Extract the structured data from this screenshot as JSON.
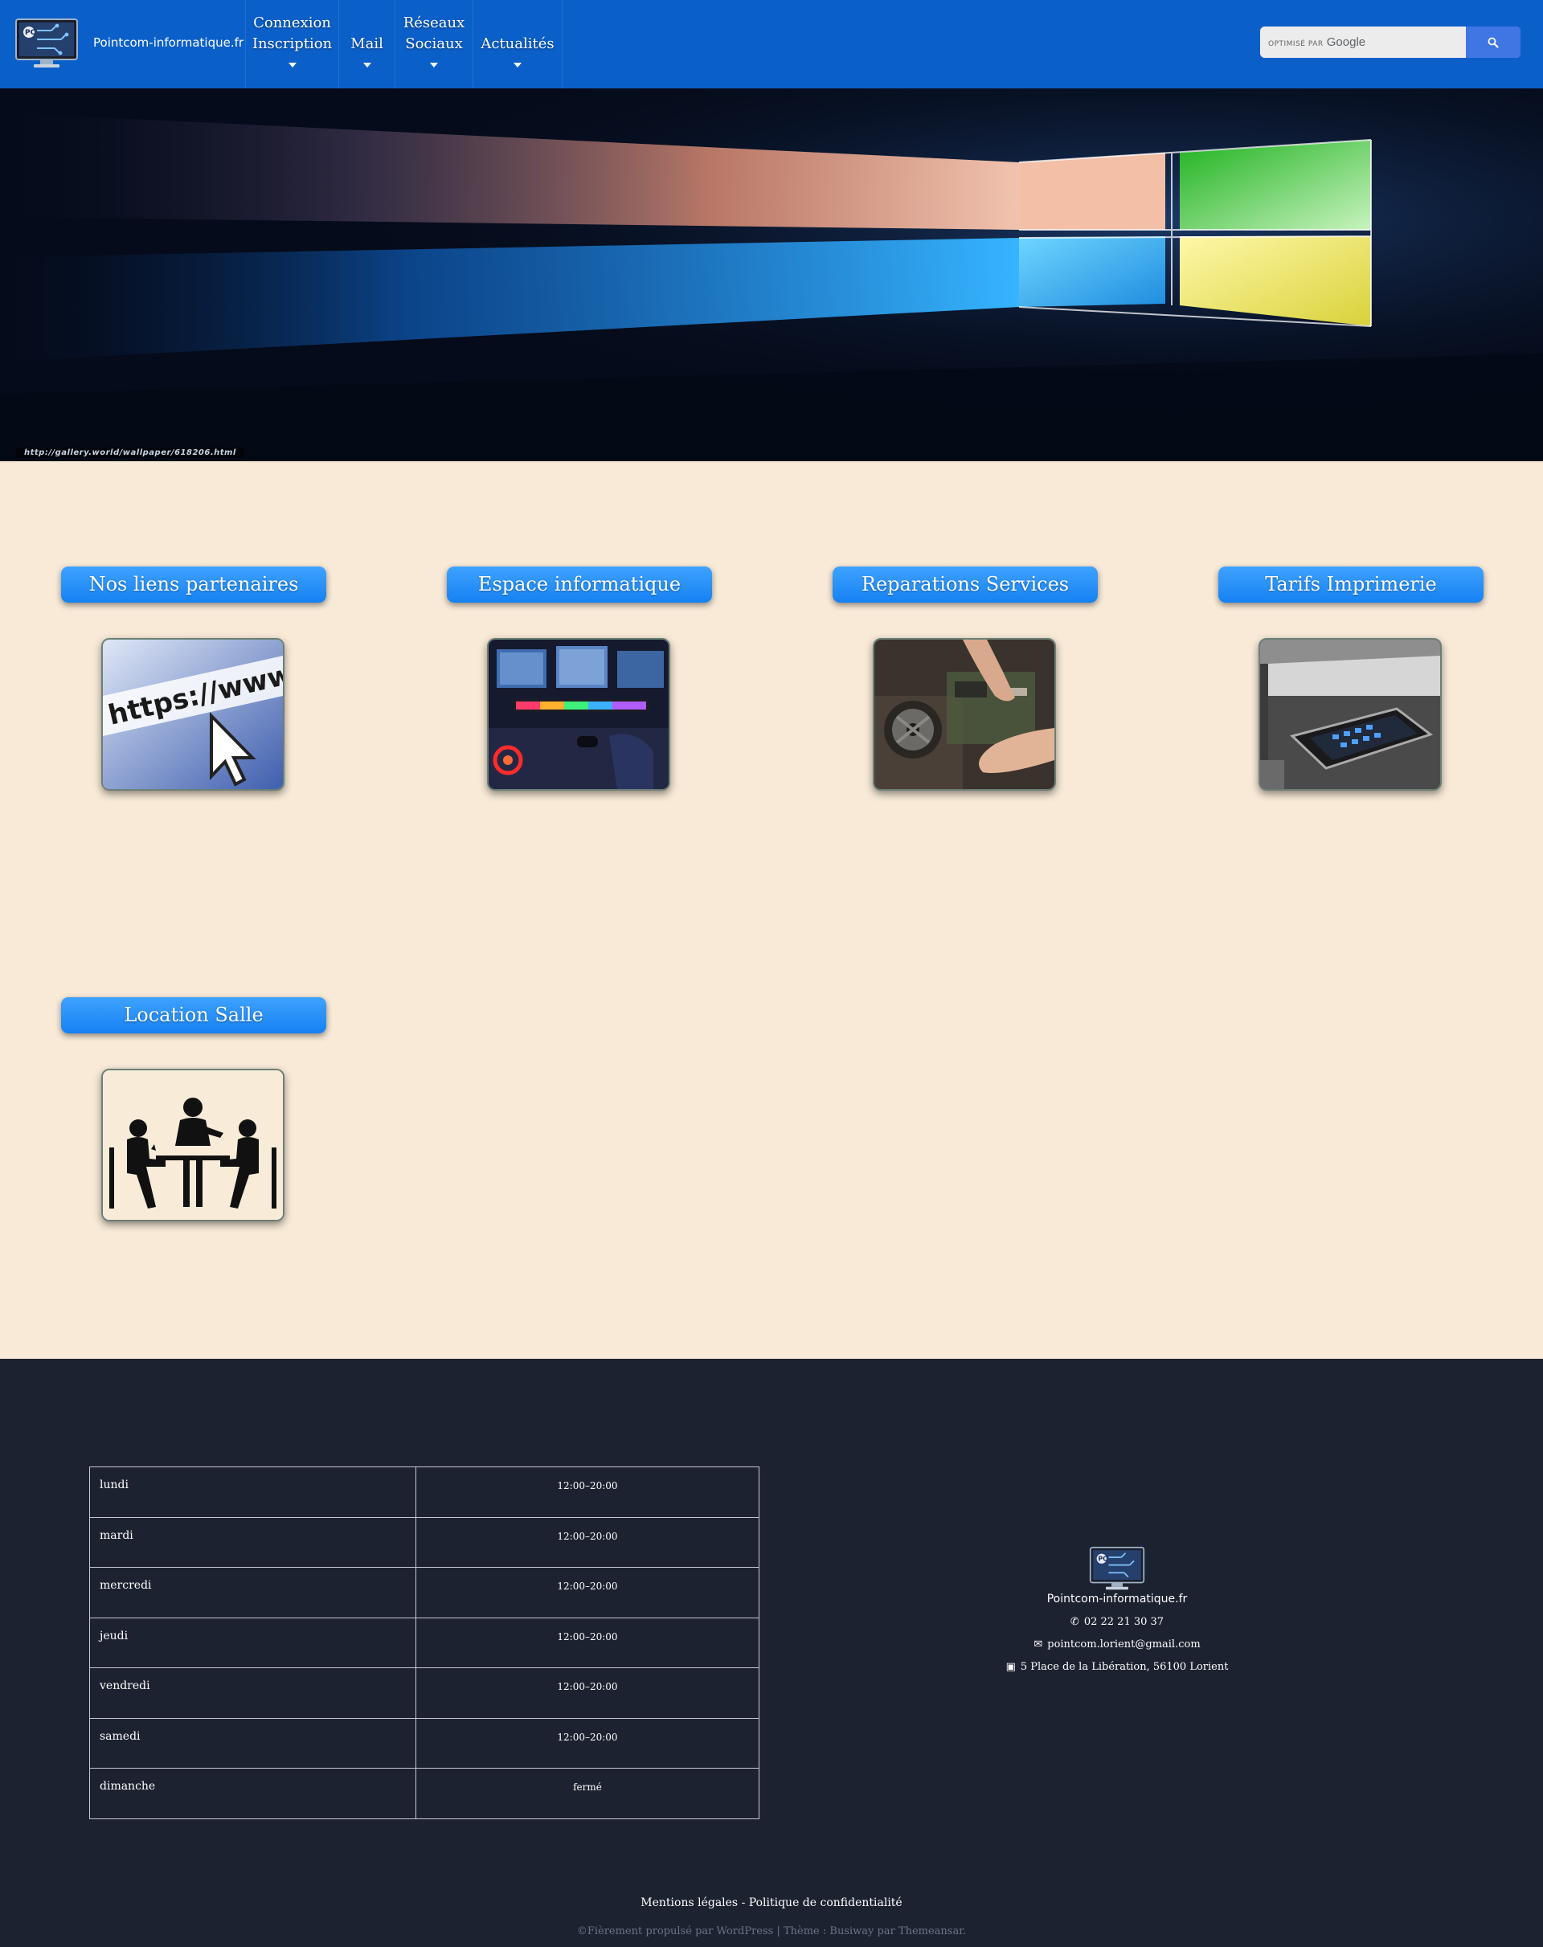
{
  "header": {
    "site_name": "Pointcom-informatique.fr",
    "nav": [
      {
        "line1": "Connexion",
        "line2": "Inscription"
      },
      {
        "line1": "Mail",
        "line2": ""
      },
      {
        "line1": "Réseaux",
        "line2": "Sociaux"
      },
      {
        "line1": "Actualités",
        "line2": ""
      }
    ],
    "search": {
      "optimise_label": "OPTIMISÉ PAR",
      "google_label": "Google"
    }
  },
  "hero": {
    "credit": "http://gallery.world/wallpaper/618206.html"
  },
  "services": [
    {
      "title": "Nos liens partenaires",
      "image": "https-url-cursor"
    },
    {
      "title": "Espace informatique",
      "image": "gaming-pc-room"
    },
    {
      "title": "Reparations Services",
      "image": "computer-repair-hands"
    },
    {
      "title": "Tarifs Imprimerie",
      "image": "office-printer"
    },
    {
      "title": "Location Salle",
      "image": "meeting-table-pictogram"
    }
  ],
  "hours": [
    {
      "day": "lundi",
      "time": "12:00–20:00"
    },
    {
      "day": "mardi",
      "time": "12:00–20:00"
    },
    {
      "day": "mercredi",
      "time": "12:00–20:00"
    },
    {
      "day": "jeudi",
      "time": "12:00–20:00"
    },
    {
      "day": "vendredi",
      "time": "12:00–20:00"
    },
    {
      "day": "samedi",
      "time": "12:00–20:00"
    },
    {
      "day": "dimanche",
      "time": "fermé"
    }
  ],
  "contact": {
    "name": "Pointcom-informatique.fr",
    "phone": "02 22 21 30 37",
    "email": "pointcom.lorient@gmail.com",
    "address": "5 Place de la Libération, 56100 Lorient"
  },
  "footer": {
    "legal": "Mentions légales - Politique de confidentialité",
    "credit": "©Fièrement propulsé par WordPress | Thème : Busiway par Themeansar."
  },
  "colors": {
    "header_bg": "#0b5fc9",
    "page_bg": "#f8ead7",
    "button_blue": "#1681f2",
    "footer_bg": "#1d2230"
  }
}
